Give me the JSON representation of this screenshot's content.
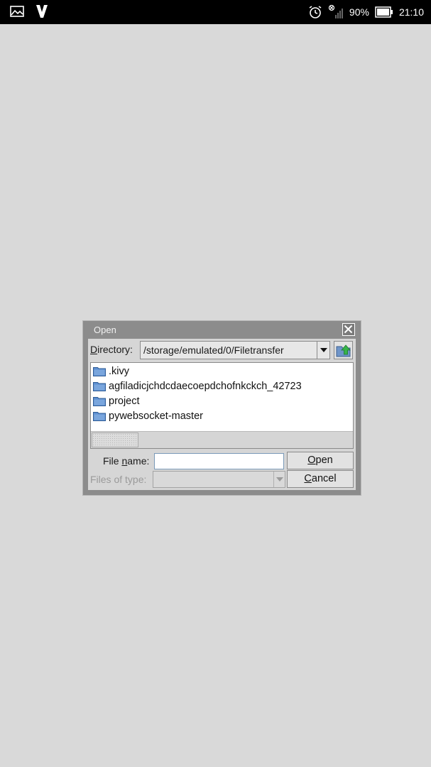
{
  "status_bar": {
    "battery": "90%",
    "time": "21:10",
    "icons": [
      "gallery-icon",
      "v-app-icon",
      "alarm-icon",
      "no-signal-icon",
      "battery-icon"
    ]
  },
  "dialog": {
    "title": "Open",
    "directory_label": "Directory:",
    "directory_value": "/storage/emulated/0/Filetransfer",
    "files": [
      {
        "name": ".kivy",
        "type": "folder"
      },
      {
        "name": "agfiladicjchdcdaecoepdchofnkckch_42723",
        "type": "folder"
      },
      {
        "name": "project",
        "type": "folder"
      },
      {
        "name": "pywebsocket-master",
        "type": "folder"
      }
    ],
    "file_name_label": "File name:",
    "file_name_value": "",
    "files_of_type_label": "Files of type:",
    "files_of_type_value": "",
    "open_label": "Open",
    "cancel_label": "Cancel"
  },
  "colors": {
    "background": "#d9d9d9",
    "dialog_frame": "#8c8c8c",
    "folder_blue": "#4a7fc1"
  }
}
